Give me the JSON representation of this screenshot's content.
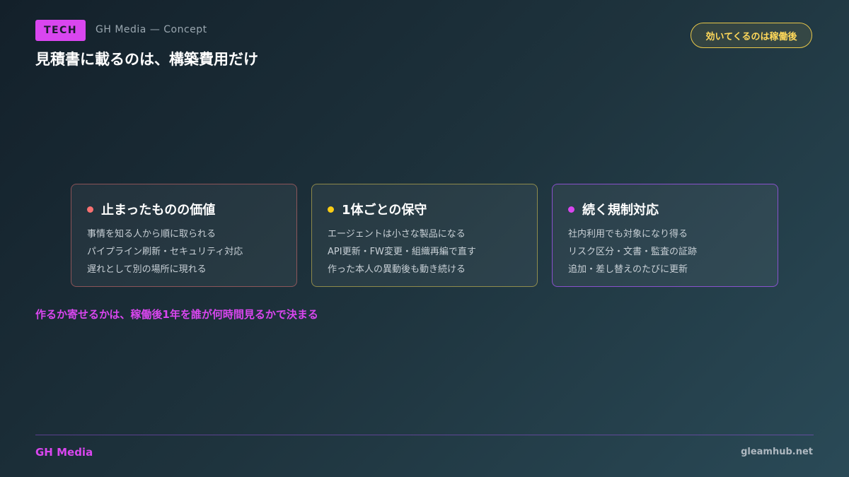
{
  "header": {
    "tag": "TECH",
    "brand_sub": "GH Media — Concept",
    "headline": "見積書に載るのは、構築費用だけ",
    "badge": "効いてくるのは稼働後"
  },
  "cards": [
    {
      "title": "止まったものの価値",
      "dot_color": "#f87171",
      "lines": [
        "事情を知る人から順に取られる",
        "パイプライン刷新・セキュリティ対応",
        "遅れとして別の場所に現れる"
      ]
    },
    {
      "title": "1体ごとの保守",
      "dot_color": "#facc15",
      "lines": [
        "エージェントは小さな製品になる",
        "API更新・FW変更・組織再編で直す",
        "作った本人の異動後も動き続ける"
      ]
    },
    {
      "title": "続く規制対応",
      "dot_color": "#d946ef",
      "lines": [
        "社内利用でも対象になり得る",
        "リスク区分・文書・監査の証跡",
        "追加・差し替えのたびに更新"
      ]
    }
  ],
  "tagline": "作るか寄せるかは、稼働後1年を誰が何時間見るかで決まる",
  "footer": {
    "brand": "GH Media",
    "url": "gleamhub.net"
  }
}
